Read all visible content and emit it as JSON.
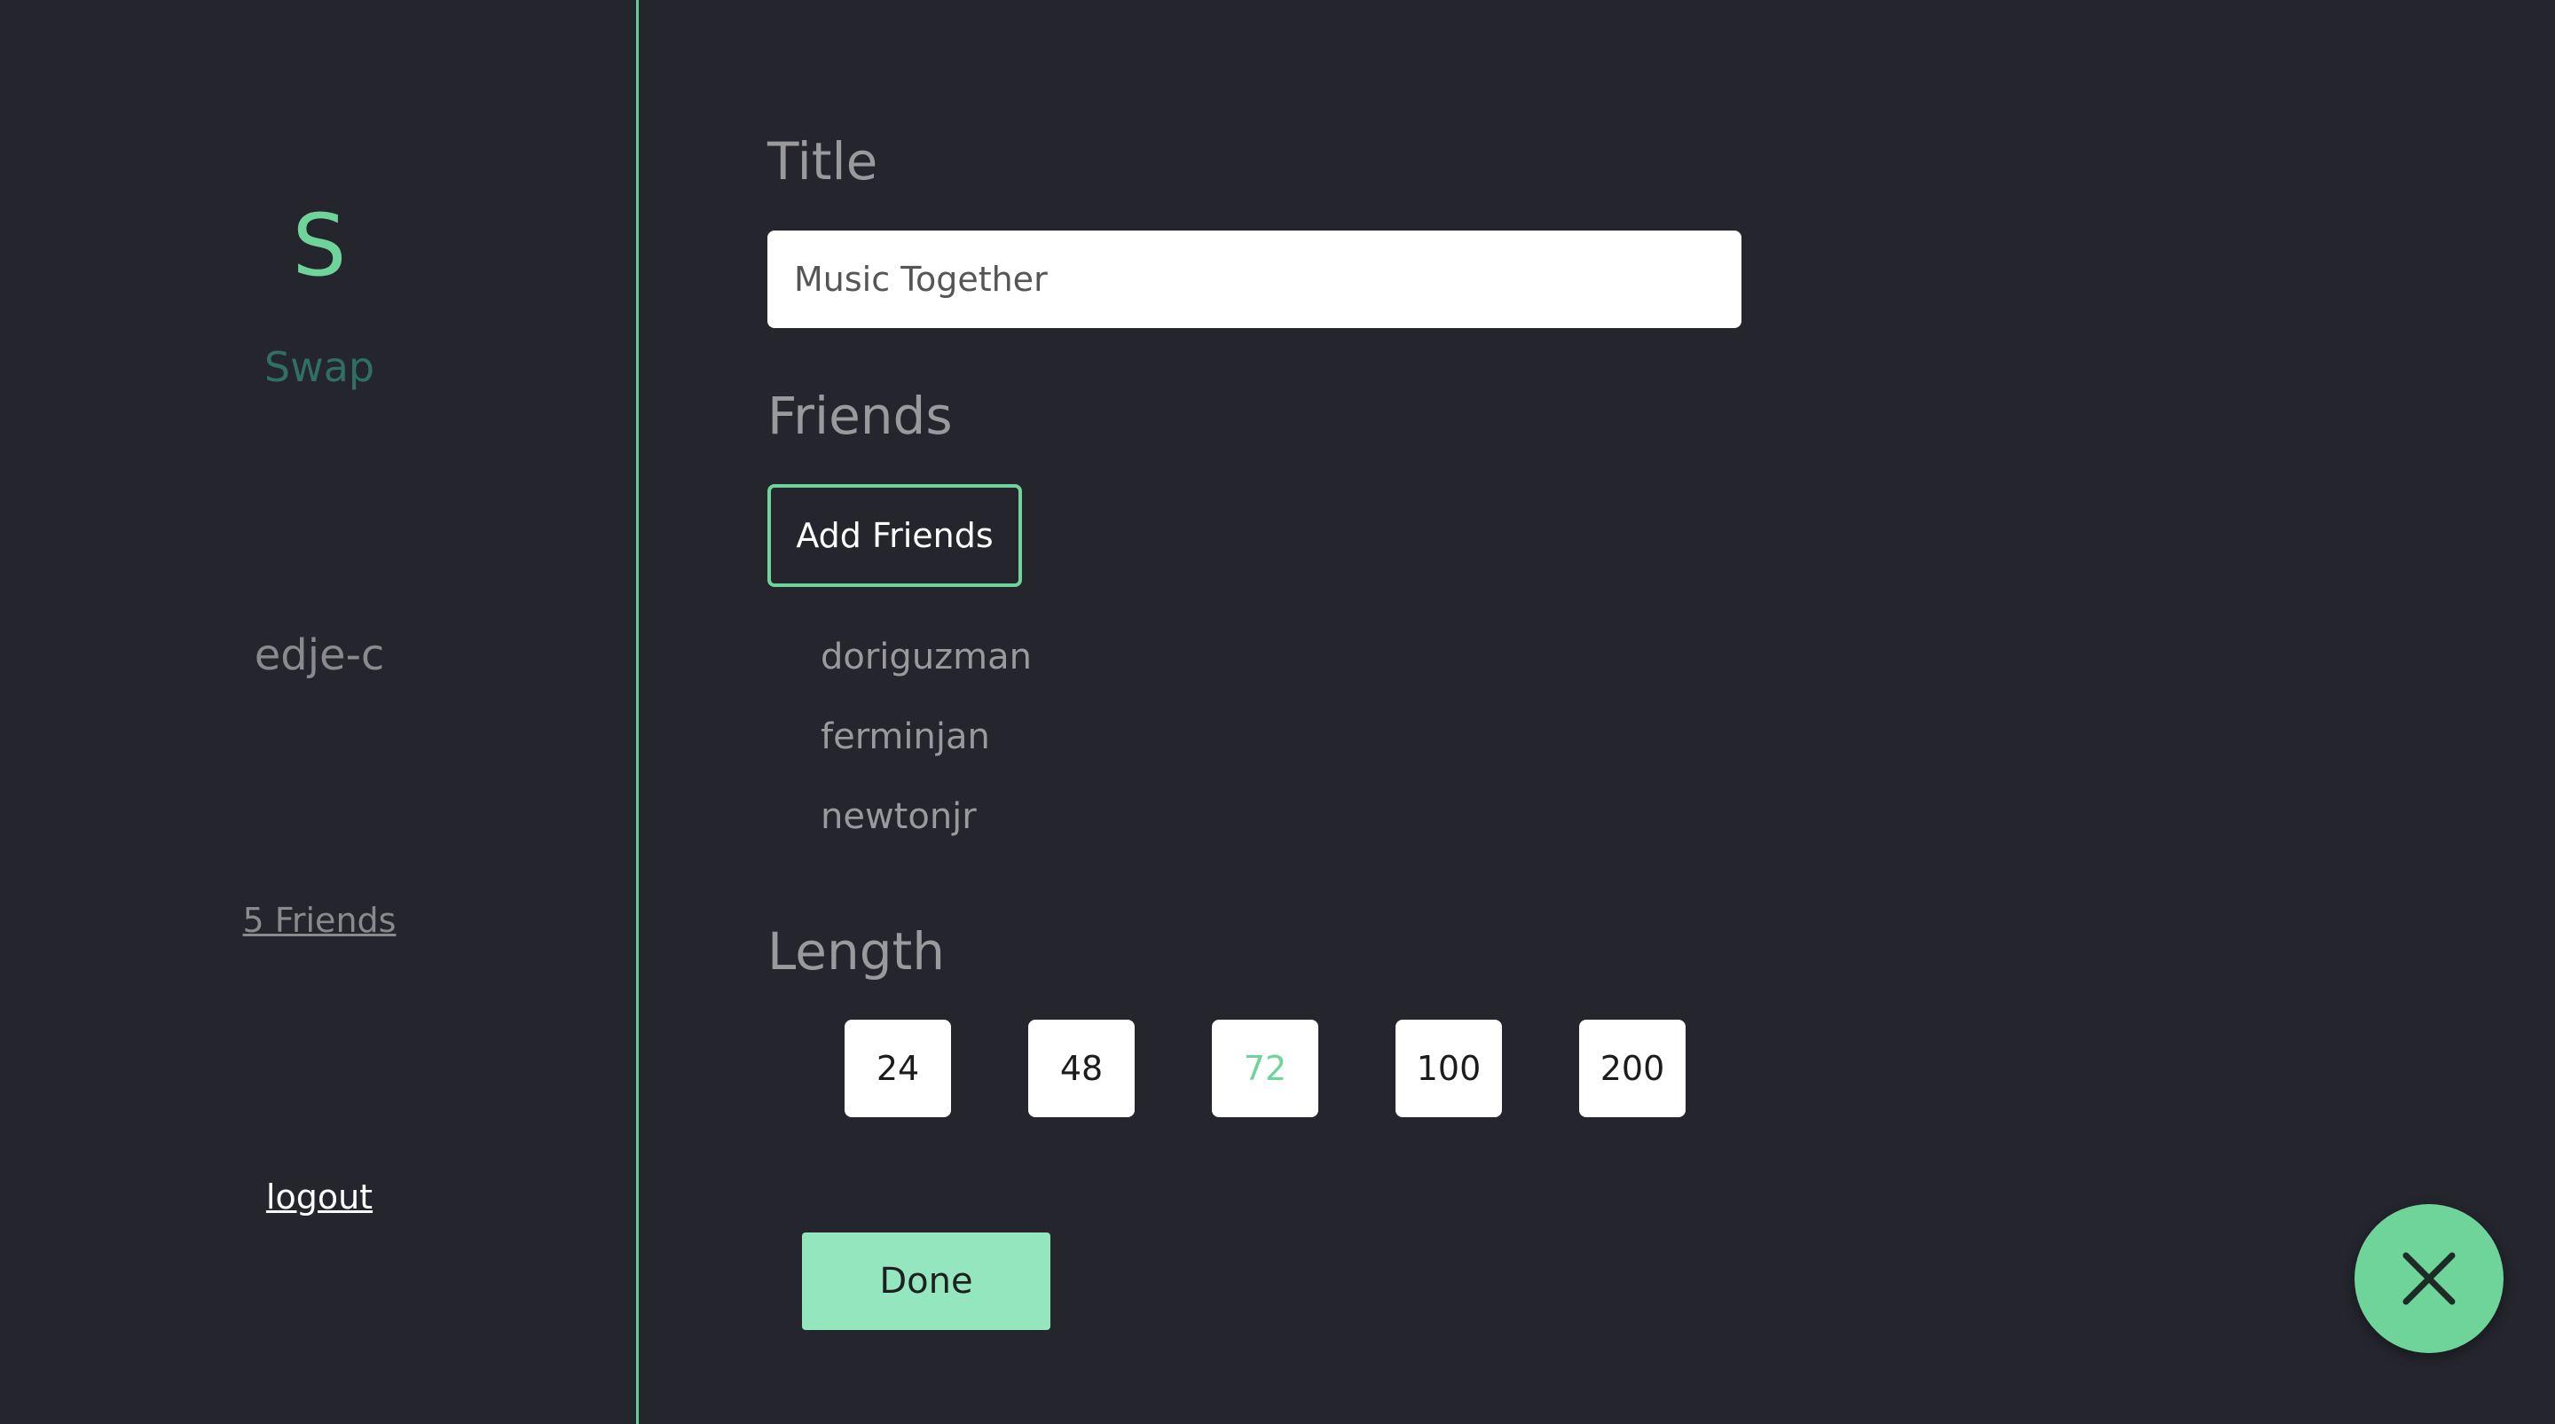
{
  "sidebar": {
    "logo_letter": "S",
    "brand_name": "Swap",
    "username": "edje-c",
    "friends_link": "5 Friends",
    "logout_label": "logout"
  },
  "form": {
    "title_heading": "Title",
    "title_value": "Music Together",
    "friends_heading": "Friends",
    "add_friends_label": "Add Friends",
    "friends": [
      "doriguzman",
      "ferminjan",
      "newtonjr"
    ],
    "length_heading": "Length",
    "length_options": [
      "24",
      "48",
      "72",
      "100",
      "200"
    ],
    "selected_length": "72",
    "done_label": "Done"
  },
  "fab": {
    "icon": "close-icon"
  },
  "colors": {
    "background": "#24252d",
    "accent": "#6fd49a",
    "brand_dark": "#2f6f64",
    "done_button": "#93e6be",
    "muted_text": "#9a9a9d"
  }
}
